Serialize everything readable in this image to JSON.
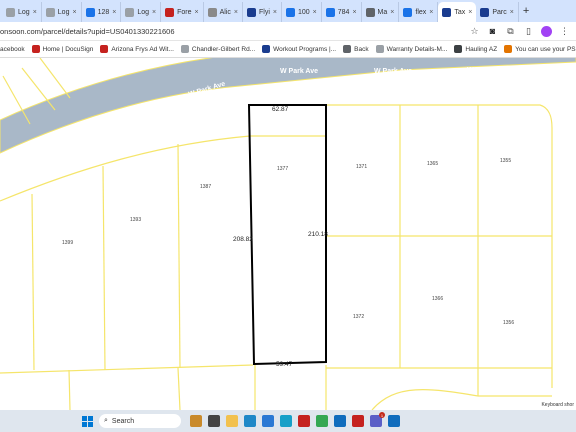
{
  "tabs": [
    {
      "label": "Log",
      "icon": "log-favicon",
      "color": "#9aa0a6"
    },
    {
      "label": "Log",
      "icon": "log-favicon",
      "color": "#9aa0a6"
    },
    {
      "label": "128",
      "icon": "page-favicon",
      "color": "#1a73e8"
    },
    {
      "label": "Log",
      "icon": "log-favicon",
      "color": "#9aa0a6"
    },
    {
      "label": "Fore",
      "icon": "fore-favicon",
      "color": "#c5221f"
    },
    {
      "label": "Alic",
      "icon": "doc-favicon",
      "color": "#8a8a8a"
    },
    {
      "label": "Flyi",
      "icon": "flyer-favicon",
      "color": "#1a3c8f"
    },
    {
      "label": "100",
      "icon": "page-favicon",
      "color": "#1a73e8"
    },
    {
      "label": "784",
      "icon": "page-favicon",
      "color": "#1a73e8"
    },
    {
      "label": "Ma",
      "icon": "mail-favicon",
      "color": "#5f6368"
    },
    {
      "label": "flex",
      "icon": "page-favicon",
      "color": "#1a73e8"
    },
    {
      "label": "Tax",
      "icon": "tax-favicon",
      "color": "#1a3c8f",
      "active": true
    },
    {
      "label": "Parc",
      "icon": "parcel-favicon",
      "color": "#1a3c8f"
    }
  ],
  "address": {
    "url": "onsoon.com/parcel/details?upid=US0401330221606"
  },
  "bookmarks": [
    {
      "label": "acebook",
      "color": "#1877f2"
    },
    {
      "label": "Home | DocuSign",
      "color": "#c5221f"
    },
    {
      "label": "Arizona Frys Ad Wit...",
      "color": "#c5221f"
    },
    {
      "label": "Chandler-Gilbert Rd...",
      "color": "#9aa0a6"
    },
    {
      "label": "Workout Programs |...",
      "color": "#1a3c8f"
    },
    {
      "label": "Back",
      "color": "#5f6368"
    },
    {
      "label": "Warranty Details-M...",
      "color": "#9aa0a6"
    },
    {
      "label": "Hauling AZ",
      "color": "#3c4043"
    },
    {
      "label": "You can use your PS...",
      "color": "#e37400"
    }
  ],
  "map": {
    "streets": [
      "W Park Ave",
      "W Park Ave",
      "W Park Ave",
      "W Park Ave"
    ],
    "parcels": [
      "1387",
      "1377",
      "1371",
      "1365",
      "1355",
      "1393",
      "1399",
      "1366",
      "1372",
      "1356"
    ],
    "dimensions": {
      "top": "62.87",
      "left": "208.82",
      "right": "210.18",
      "bottom": "59.47"
    },
    "attribution": "Keyboard shor",
    "colors": {
      "road": "#a9b8c8",
      "parcel_line": "#f5e56b",
      "selected": "#000000"
    }
  },
  "taskbar": {
    "search_label": "Search",
    "apps": [
      {
        "icon": "widgets-icon",
        "color": "#c98a2b"
      },
      {
        "icon": "task-view-icon",
        "color": "#444444"
      },
      {
        "icon": "file-explorer-icon",
        "color": "#f2c14e"
      },
      {
        "icon": "edge-icon",
        "color": "#1e88c8"
      },
      {
        "icon": "store-icon",
        "color": "#2b79d4"
      },
      {
        "icon": "meet-icon",
        "color": "#16a0c8"
      },
      {
        "icon": "mcafee-icon",
        "color": "#c5221f"
      },
      {
        "icon": "chrome-icon",
        "color": "#34a853"
      },
      {
        "icon": "outlook-icon",
        "color": "#0f6cbd"
      },
      {
        "icon": "mcafee2-icon",
        "color": "#c5221f"
      },
      {
        "icon": "teams-icon",
        "color": "#5b5fc7"
      },
      {
        "icon": "notification-icon",
        "color": "#0f6cbd"
      }
    ],
    "badge": "1"
  }
}
